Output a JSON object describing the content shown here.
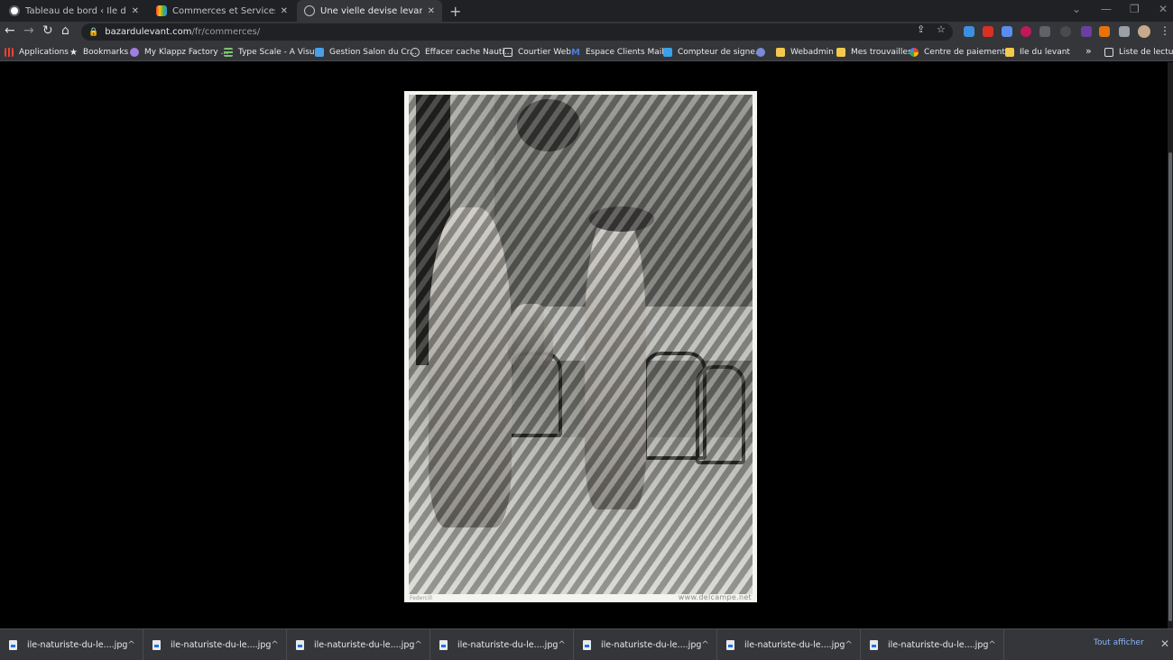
{
  "tabs": [
    {
      "title": "Tableau de bord ‹ Ile du Levant D",
      "favicon": "wordpress-icon",
      "close": "✕"
    },
    {
      "title": "Commerces et Services - Ile du Le",
      "favicon": "site-rainbow-icon",
      "close": "✕"
    },
    {
      "title": "Une vielle devise levantine dit: «J",
      "favicon": "globe-icon",
      "close": "✕"
    }
  ],
  "new_tab": "+",
  "window_controls": {
    "dropdown": "⌄",
    "minimize": "—",
    "restore": "❐",
    "close": "✕"
  },
  "nav": {
    "back": "←",
    "forward": "→",
    "reload": "↻",
    "home": "⌂"
  },
  "address": {
    "lock": "🔒",
    "host": "bazardulevant.com",
    "path": "/fr/commerces/"
  },
  "omnibox_icons": {
    "share": "⇪",
    "star": "☆"
  },
  "bookmarks": [
    {
      "label": "Applications",
      "icon": "apps-grid-icon",
      "color": "#ea4335"
    },
    {
      "label": "Bookmarks",
      "icon": "star-icon",
      "color": "#e8eaed"
    },
    {
      "label": "My Klappz Factory ...",
      "icon": "heart-shield-icon",
      "color": "#9f7fe0"
    },
    {
      "label": "Type Scale - A Visu...",
      "icon": "type-scale-icon",
      "color": "#7cc36e"
    },
    {
      "label": "Gestion Salon du Cr...",
      "icon": "gestion-icon",
      "color": "#4aa0e6"
    },
    {
      "label": "Effacer cache Nauti...",
      "icon": "globe-icon",
      "color": "#dadce0"
    },
    {
      "label": "Courtier Web",
      "icon": "document-icon",
      "color": "#dadce0"
    },
    {
      "label": "Espace Clients Mail...",
      "icon": "m-letter-icon",
      "color": "#4a7de0"
    },
    {
      "label": "Compteur de signe...",
      "icon": "mail-icon",
      "color": "#3aa0e8"
    },
    {
      "label": "",
      "icon": "hex-icon",
      "color": "#7a8ad8"
    },
    {
      "label": "Webadmin",
      "icon": "folder-icon",
      "color": "#f2c94c"
    },
    {
      "label": "Mes trouvailles",
      "icon": "folder-icon",
      "color": "#f2c94c"
    },
    {
      "label": "Centre de paiement...",
      "icon": "google-icon",
      "color": "#4285f4"
    },
    {
      "label": "Ile du levant",
      "icon": "folder-icon",
      "color": "#f2c94c"
    }
  ],
  "bookmarks_more": "»",
  "reading_list": "Liste de lecture",
  "photo": {
    "caption_left": "Federcill",
    "caption_right": "www.delcampe.net"
  },
  "downloads": [
    {
      "name": "ile-naturiste-du-le....jpg",
      "caret": "^"
    },
    {
      "name": "ile-naturiste-du-le....jpg",
      "caret": "^"
    },
    {
      "name": "ile-naturiste-du-le....jpg",
      "caret": "^"
    },
    {
      "name": "ile-naturiste-du-le....jpg",
      "caret": "^"
    },
    {
      "name": "ile-naturiste-du-le....jpg",
      "caret": "^"
    },
    {
      "name": "ile-naturiste-du-le....jpg",
      "caret": "^"
    },
    {
      "name": "ile-naturiste-du-le....jpg",
      "caret": "^"
    }
  ],
  "show_all": "Tout afficher",
  "shelf_close": "✕"
}
